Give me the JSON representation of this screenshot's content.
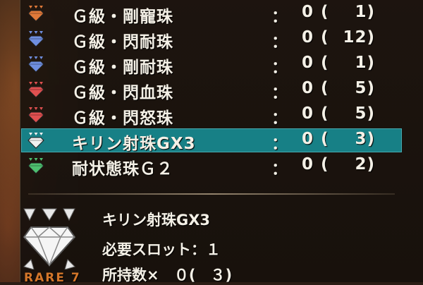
{
  "list": {
    "items": [
      {
        "name": "Ｇ級・剛寵珠",
        "colon": "：",
        "qty": "0",
        "paren": "(",
        "total": "1)",
        "gem_color": "#e07a3a"
      },
      {
        "name": "Ｇ級・閃耐珠",
        "colon": "：",
        "qty": "0",
        "paren": "(",
        "total": "12)",
        "gem_color": "#6f8fe0"
      },
      {
        "name": "Ｇ級・剛耐珠",
        "colon": "：",
        "qty": "0",
        "paren": "(",
        "total": "1)",
        "gem_color": "#6f8fe0"
      },
      {
        "name": "Ｇ級・閃血珠",
        "colon": "：",
        "qty": "0",
        "paren": "(",
        "total": "5)",
        "gem_color": "#e05050"
      },
      {
        "name": "Ｇ級・閃怒珠",
        "colon": "：",
        "qty": "0",
        "paren": "(",
        "total": "5)",
        "gem_color": "#e05050"
      },
      {
        "name": "キリン射珠GX3",
        "colon": "：",
        "qty": "0",
        "paren": "(",
        "total": "3)",
        "gem_color": "#f0f0f0"
      },
      {
        "name": "耐状態珠Ｇ２",
        "colon": "：",
        "qty": "0",
        "paren": "(",
        "total": "2)",
        "gem_color": "#4ec070"
      }
    ]
  },
  "detail": {
    "name": "キリン射珠GX3",
    "slots": "必要スロット：１",
    "owned_label": "所持数×",
    "owned_value": "０(　３)",
    "rare": "RARE 7",
    "gem_color": "#f0f0f0"
  }
}
